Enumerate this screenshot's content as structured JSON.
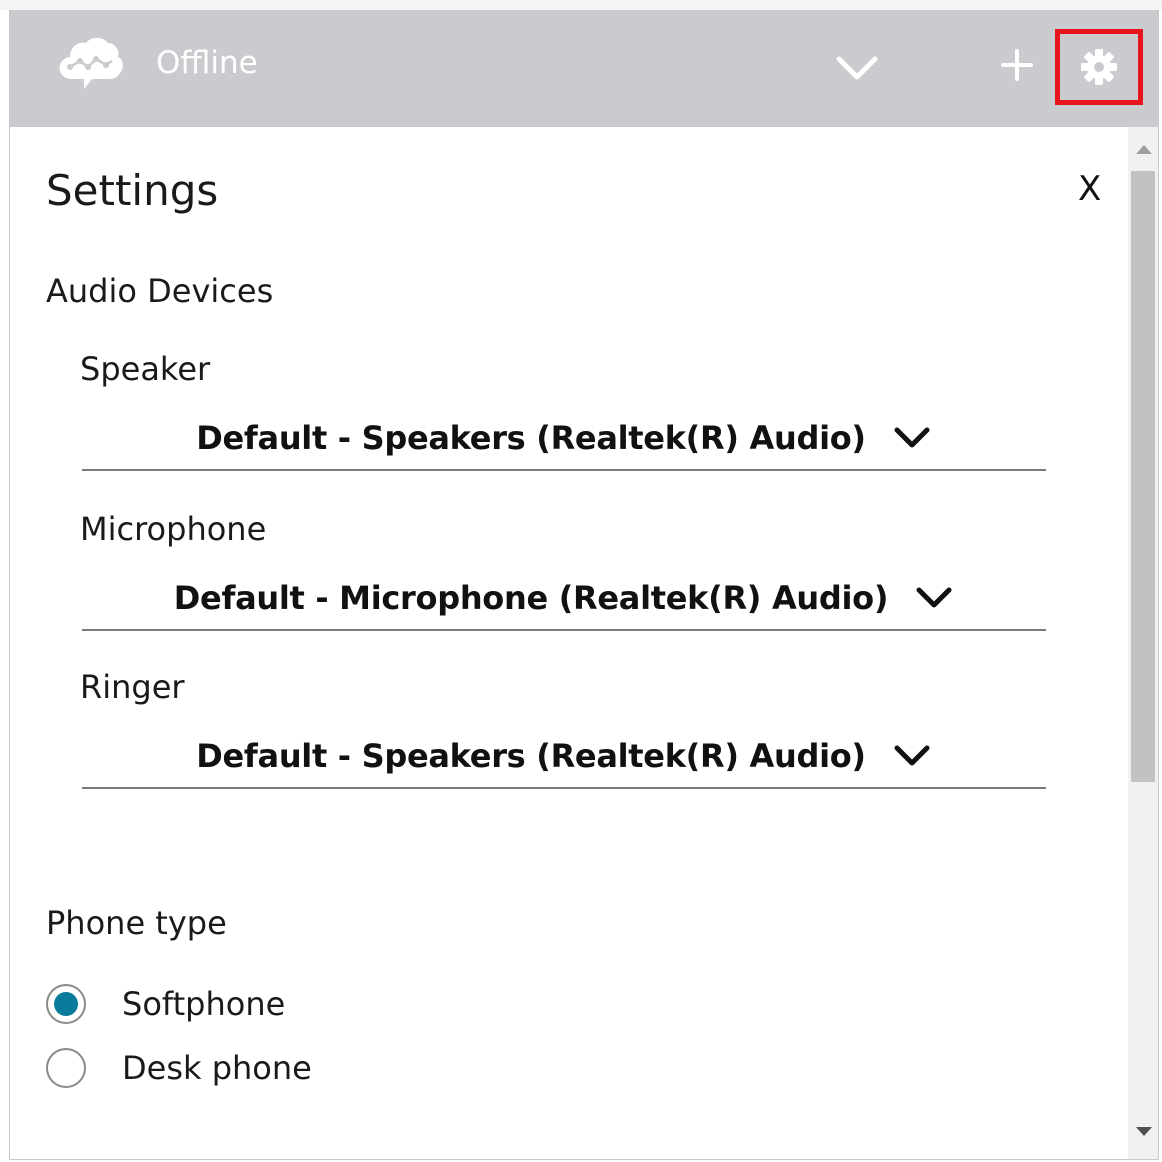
{
  "header": {
    "status": "Offline",
    "icons": {
      "logo": "cloud-logo-icon",
      "status_dropdown": "chevron-down-icon",
      "add": "plus-icon",
      "settings": "gear-icon"
    },
    "highlight_color": "#e8141d",
    "background_color": "#c9cbce"
  },
  "settings": {
    "title": "Settings",
    "close_label": "X",
    "audio_devices": {
      "title": "Audio Devices",
      "fields": [
        {
          "label": "Speaker",
          "value": "Default - Speakers (Realtek(R) Audio)"
        },
        {
          "label": "Microphone",
          "value": "Default - Microphone (Realtek(R) Audio)"
        },
        {
          "label": "Ringer",
          "value": "Default - Speakers (Realtek(R) Audio)"
        }
      ]
    },
    "phone_type": {
      "title": "Phone type",
      "options": [
        {
          "label": "Softphone",
          "selected": true
        },
        {
          "label": "Desk phone",
          "selected": false
        }
      ],
      "accent_color": "#0a7b9c"
    }
  }
}
